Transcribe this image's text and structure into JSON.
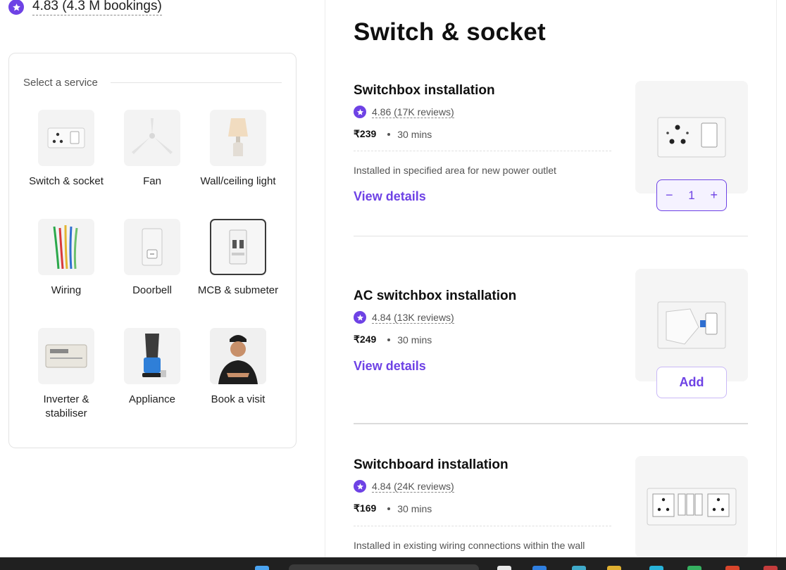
{
  "header": {
    "rating_text": "4.83 (4.3 M bookings)"
  },
  "service_selector": {
    "heading": "Select a service",
    "tiles": [
      {
        "label": "Switch & socket",
        "icon": "switch-socket-thumb"
      },
      {
        "label": "Fan",
        "icon": "ceiling-fan-thumb"
      },
      {
        "label": "Wall/ceiling light",
        "icon": "lamp-thumb"
      },
      {
        "label": "Wiring",
        "icon": "wires-thumb"
      },
      {
        "label": "Doorbell",
        "icon": "doorbell-thumb"
      },
      {
        "label": "MCB & submeter",
        "icon": "mcb-thumb",
        "selected": true
      },
      {
        "label": "Inverter & stabiliser",
        "icon": "inverter-thumb"
      },
      {
        "label": "Appliance",
        "icon": "mixer-thumb"
      },
      {
        "label": "Book a visit",
        "icon": "technician-thumb"
      }
    ]
  },
  "section": {
    "title": "Switch & socket",
    "items": [
      {
        "name": "Switchbox installation",
        "rating": "4.86 (17K reviews)",
        "price": "₹239",
        "duration": "30 mins",
        "description": "Installed in specified area for new power outlet",
        "view_details": "View details",
        "quantity": "1",
        "minus": "−",
        "plus": "+"
      },
      {
        "name": "AC switchbox installation",
        "rating": "4.84 (13K reviews)",
        "price": "₹249",
        "duration": "30 mins",
        "view_details": "View details",
        "add_label": "Add"
      },
      {
        "name": "Switchboard installation",
        "rating": "4.84 (24K reviews)",
        "price": "₹169",
        "duration": "30 mins",
        "description": "Installed in existing wiring connections within the wall"
      }
    ]
  },
  "colors": {
    "accent": "#6e42e5",
    "text": "#0f0f0f",
    "muted": "#545454"
  }
}
